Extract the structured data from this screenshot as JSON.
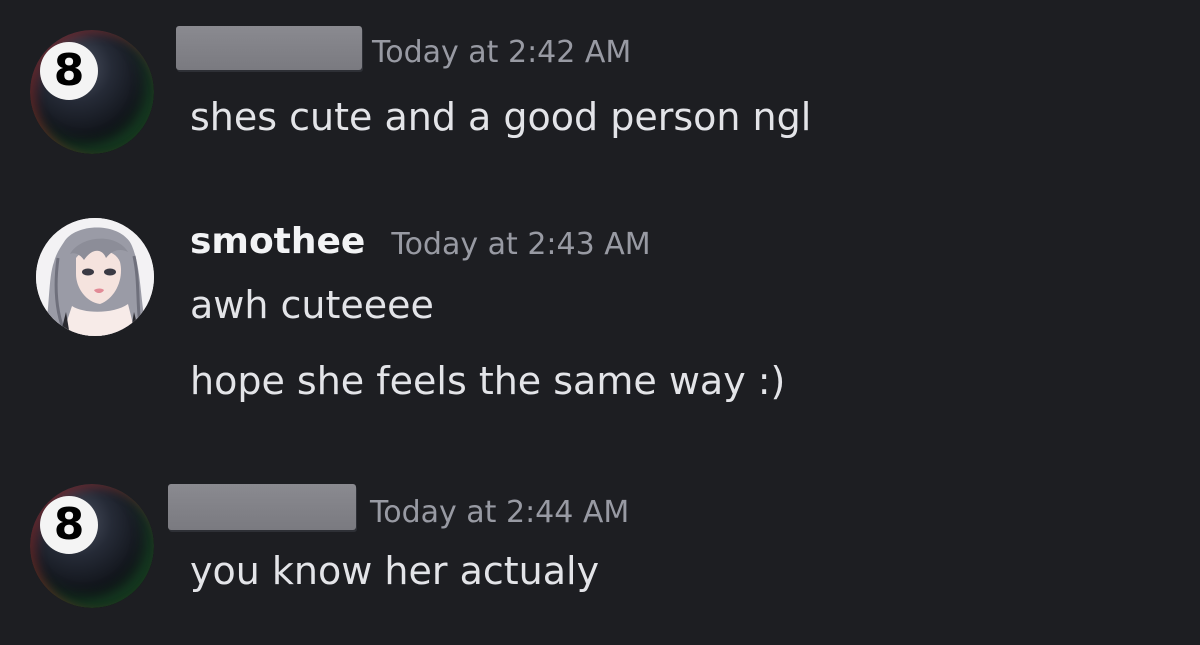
{
  "messages": [
    {
      "author": "",
      "author_redacted": true,
      "avatar": "eight-ball-icon",
      "avatar_badge": "8",
      "timestamp": "Today at 2:42 AM",
      "lines": [
        "shes cute and a good person ngl"
      ]
    },
    {
      "author": "smothee",
      "author_redacted": false,
      "avatar": "anime-girl-avatar",
      "timestamp": "Today at 2:43 AM",
      "lines": [
        "awh cuteeee",
        "hope she feels the same way :)"
      ]
    },
    {
      "author": "",
      "author_redacted": true,
      "avatar": "eight-ball-icon",
      "avatar_badge": "8",
      "timestamp": "Today at 2:44 AM",
      "lines": [
        "you know her actualy"
      ]
    }
  ],
  "colors": {
    "background": "#1d1e22",
    "username": "#f2f3f5",
    "timestamp": "#989aa3",
    "message_text": "#e3e4e8",
    "redaction": "#7f7f85"
  }
}
